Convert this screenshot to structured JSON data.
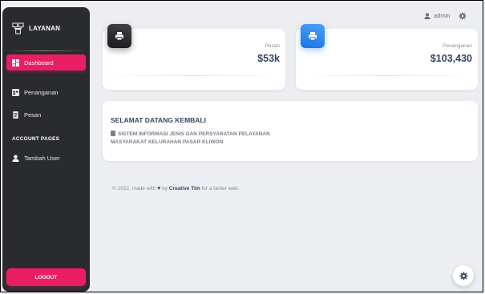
{
  "brand": {
    "name": "LAYANAN"
  },
  "sidebar": {
    "items": [
      {
        "label": "Dashboard",
        "icon": "dashboard-icon",
        "active": true
      },
      {
        "label": "Penanganan",
        "icon": "table-icon",
        "active": false
      },
      {
        "label": "Pesan",
        "icon": "receipt-icon",
        "active": false
      }
    ],
    "section": "ACCOUNT PAGES",
    "account_items": [
      {
        "label": "Tambah User",
        "icon": "person-icon"
      }
    ],
    "logout": "LOGOUT"
  },
  "topbar": {
    "user": "admin"
  },
  "stats": [
    {
      "label": "Pesan",
      "value": "$53k",
      "icon": "print-icon",
      "color": "#191919"
    },
    {
      "label": "Penanganan",
      "value": "$103,430",
      "icon": "print-icon",
      "color": "#1a73e8"
    }
  ],
  "welcome": {
    "title": "SELAMAT DATANG KEMBALI",
    "subtitle": "SISTEM INFORMASI JENIS DAN PERSYARATAN PELAYANAN MASYARAKAT KELURAHAN PASAR KLIWON"
  },
  "footer": {
    "prefix": "© 2022, made with",
    "by": "by",
    "author": "Creative Tim",
    "suffix": "for a better web."
  },
  "colors": {
    "accent": "#e91e63",
    "sidebar": "#2a2b2e",
    "background": "#eceef2"
  }
}
